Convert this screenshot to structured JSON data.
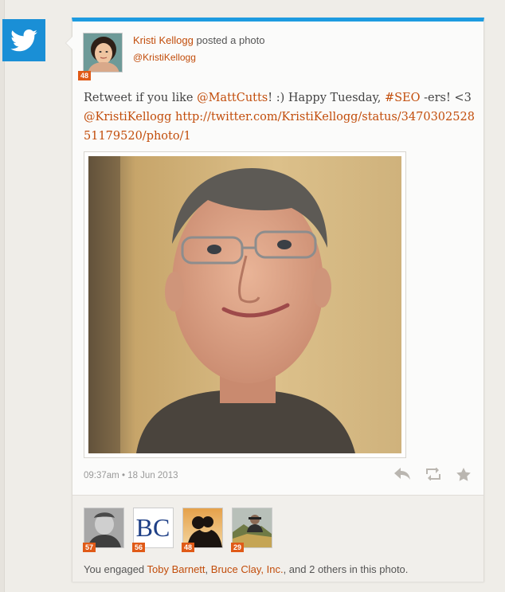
{
  "network": {
    "icon": "twitter-bird-icon",
    "color": "#1a8fd6"
  },
  "post": {
    "author_name": "Kristi Kellogg",
    "action_text": " posted a photo",
    "handle": "@KristiKellogg",
    "author_score": "48",
    "text_parts": [
      "Retweet if you like ",
      "@MattCutts",
      "! :) Happy Tuesday, ",
      "#SEO",
      " -ers! <3 ",
      "@KristiKellogg",
      " ",
      "http://twitter.com/KristiKellogg/status/347030252851179520/photo/1"
    ],
    "timestamp": "09:37am",
    "separator": " • ",
    "date": "18 Jun 2013"
  },
  "engagement": {
    "users": [
      {
        "score": "57",
        "icon": "user-avatar-portrait"
      },
      {
        "score": "56",
        "icon": "bc-logo"
      },
      {
        "score": "48",
        "icon": "silhouette-couple"
      },
      {
        "score": "29",
        "icon": "landscape-person"
      }
    ],
    "prefix": "You engaged ",
    "name1": "Toby Barnett",
    "comma": ", ",
    "name2": "Bruce Clay, Inc.",
    "suffix": ", and 2 others in this photo."
  },
  "colors": {
    "accent": "#1d9be0",
    "link": "#c24d0b",
    "badge": "#e05a17"
  }
}
